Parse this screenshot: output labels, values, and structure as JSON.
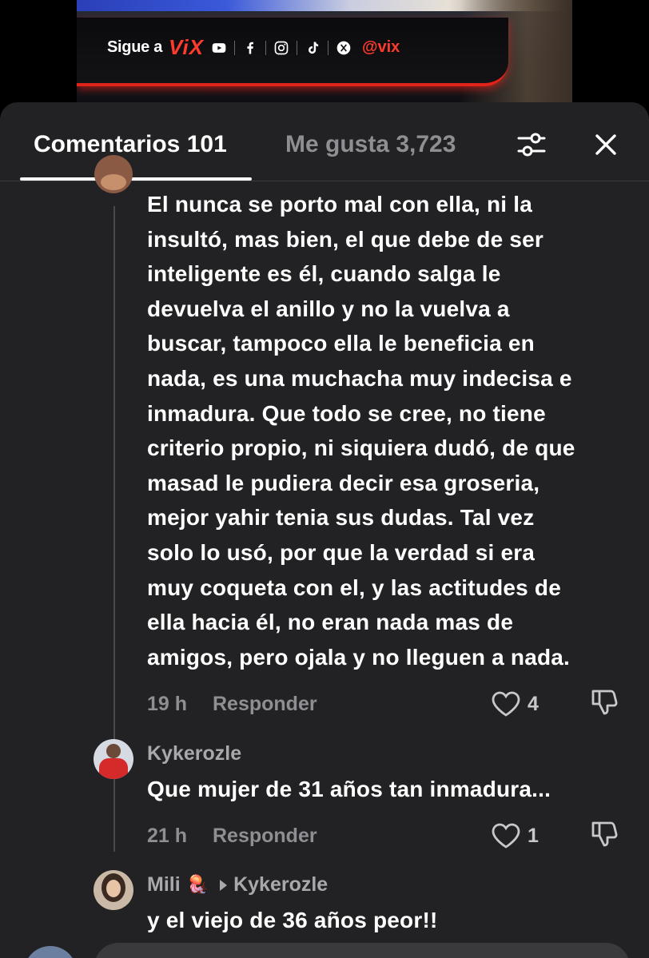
{
  "video": {
    "banner_text": "Sigue a",
    "banner_brand": "ViX",
    "banner_handle": "@vix",
    "social_icons": [
      "youtube-icon",
      "facebook-icon",
      "instagram-icon",
      "tiktok-icon",
      "x-icon"
    ]
  },
  "header": {
    "tab_comments": "Comentarios 101",
    "tab_likes": "Me gusta 3,723",
    "icons": [
      "filter-icon",
      "close-icon"
    ]
  },
  "comments": [
    {
      "text_lines": [
        "El nunca se porto mal con ella, ni la",
        "insultó, mas bien, el que debe de ser",
        "inteligente es él, cuando salga le",
        "devuelva el anillo y no la vuelva a",
        "buscar, tampoco ella le beneficia en",
        "nada, es una muchacha muy indecisa e",
        "inmadura. Que todo se cree, no tiene",
        "criterio propio, ni siquiera dudó, de que",
        "masad le pudiera decir esa groseria,",
        "mejor yahir tenia sus dudas. Tal vez",
        "solo lo usó, por que la verdad si era",
        "muy coqueta con el, y las actitudes de",
        "ella hacia él, no eran nada mas de",
        "amigos, pero ojala y no lleguen a nada."
      ],
      "time": "19 h",
      "reply_label": "Responder",
      "likes": "4"
    },
    {
      "username": "Kykerozle",
      "text": "Que mujer de 31 años tan inmadura...",
      "time": "21 h",
      "reply_label": "Responder",
      "likes": "1"
    },
    {
      "username": "Mili",
      "username_emoji": "🪼",
      "reply_to": "Kykerozle",
      "text": "y el viejo de 36 años peor!!"
    }
  ],
  "colors": {
    "sheet_bg": "#222224",
    "muted_text": "#8e8e93",
    "accent_red": "#e2231a"
  }
}
